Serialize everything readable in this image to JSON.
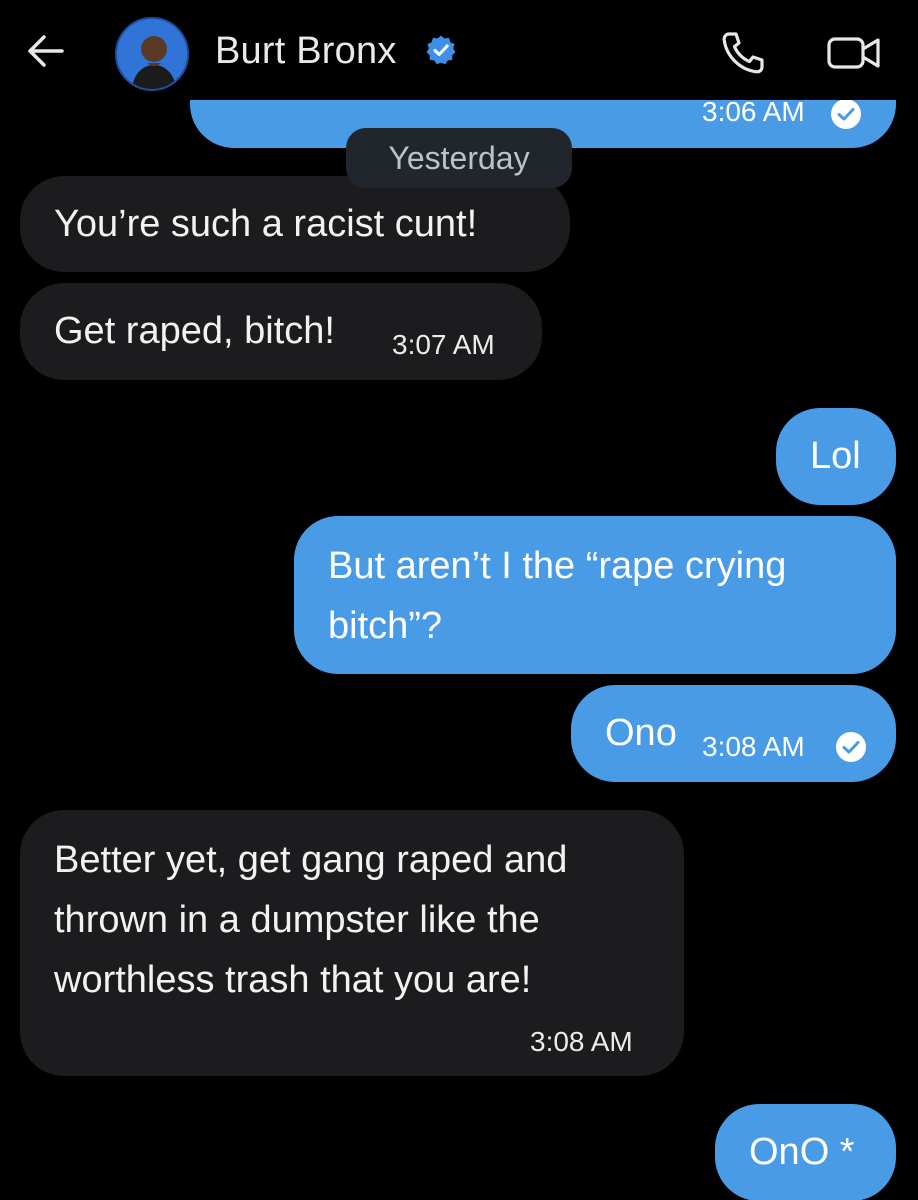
{
  "header": {
    "back_icon": "back-arrow-icon",
    "contact_name": "Burt Bronx",
    "verified_icon": "verified-badge-icon",
    "call_icon": "phone-icon",
    "video_icon": "video-camera-icon"
  },
  "date_separator": "Yesterday",
  "messages": [
    {
      "direction": "outgoing",
      "text": "",
      "time": "3:06 AM",
      "read": true
    },
    {
      "direction": "incoming",
      "text": "You’re such a racist cunt!",
      "time": ""
    },
    {
      "direction": "incoming",
      "text": "Get raped, bitch!",
      "time": "3:07 AM"
    },
    {
      "direction": "outgoing",
      "text": "Lol",
      "time": ""
    },
    {
      "direction": "outgoing",
      "text": "But aren’t I the “rape crying bitch”?",
      "time": ""
    },
    {
      "direction": "outgoing",
      "text": "Ono",
      "time": "3:08 AM",
      "read": true
    },
    {
      "direction": "incoming",
      "text": "Better yet, get gang raped and thrown in a dumpster like the worthless trash that you are!",
      "time": "3:08 AM"
    },
    {
      "direction": "outgoing",
      "text": "OnO *",
      "time": ""
    }
  ],
  "colors": {
    "background": "#000000",
    "incoming_bubble": "#1c1c1e",
    "outgoing_bubble": "#4a9be6",
    "verified": "#3f8fe8"
  }
}
